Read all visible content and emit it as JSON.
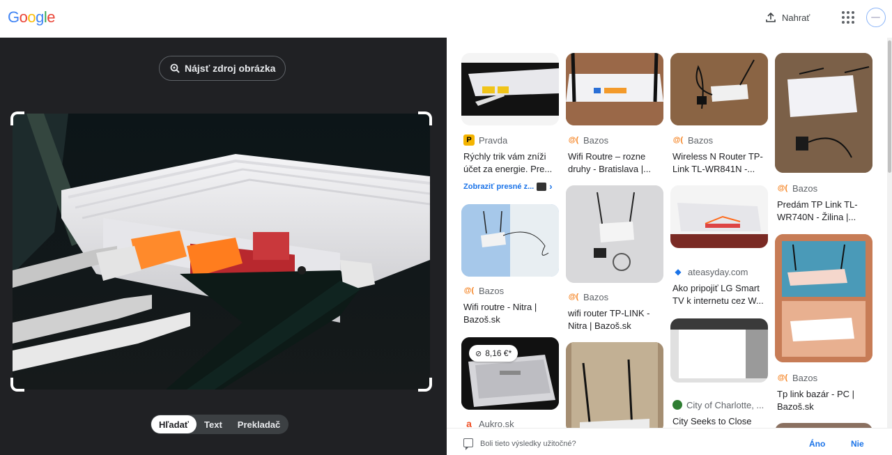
{
  "header": {
    "logo": [
      "G",
      "o",
      "o",
      "g",
      "l",
      "e"
    ],
    "logo_colors": [
      "#4285f4",
      "#ea4335",
      "#fbbc05",
      "#4285f4",
      "#34a853",
      "#ea4335"
    ],
    "upload_label": "Nahrať"
  },
  "left": {
    "find_source_label": "Nájsť zdroj obrázka",
    "tabs": [
      "Hľadať",
      "Text",
      "Prekladač"
    ]
  },
  "results": [
    {
      "source": "Pravda",
      "icon": "P",
      "title": "Rýchly trik vám zníži účet za energie. Pre...",
      "exact": "Zobraziť presné z..."
    },
    {
      "source": "Bazos",
      "icon": "@(",
      "title": "Wifi Routre – rozne druhy - Bratislava |..."
    },
    {
      "source": "Bazos",
      "icon": "@(",
      "title": "Wireless N Router TP-Link TL-WR841N -..."
    },
    {
      "source": "Bazos",
      "icon": "@(",
      "title": "Predám TP Link TL-WR740N - Žilina |..."
    },
    {
      "source": "Bazos",
      "icon": "@(",
      "title": "Wifi routre - Nitra | Bazoš.sk"
    },
    {
      "source": "Bazos",
      "icon": "@(",
      "title": "wifi router TP-LINK - Nitra | Bazoš.sk"
    },
    {
      "source": "ateasyday.com",
      "icon": "tag",
      "title": "Ako pripojiť LG Smart TV k internetu cez W..."
    },
    {
      "source": "Bazos",
      "icon": "@(",
      "title": "Tp link bazár - PC | Bazoš.sk"
    },
    {
      "source": "Aukro.sk",
      "icon": "a",
      "price": "8,16 €*"
    },
    {
      "source": "City of Charlotte, ...",
      "icon": "seal",
      "title": "City Seeks to Close"
    }
  ],
  "colors": {
    "link_blue": "#1a73e8",
    "bazos_orange": "#f58220",
    "aukro_red": "#f04e23",
    "pravda_yellow": "#f4b400",
    "dark_panel": "#202124"
  },
  "feedback": {
    "question": "Boli tieto výsledky užitočné?",
    "yes": "Áno",
    "no": "Nie"
  }
}
